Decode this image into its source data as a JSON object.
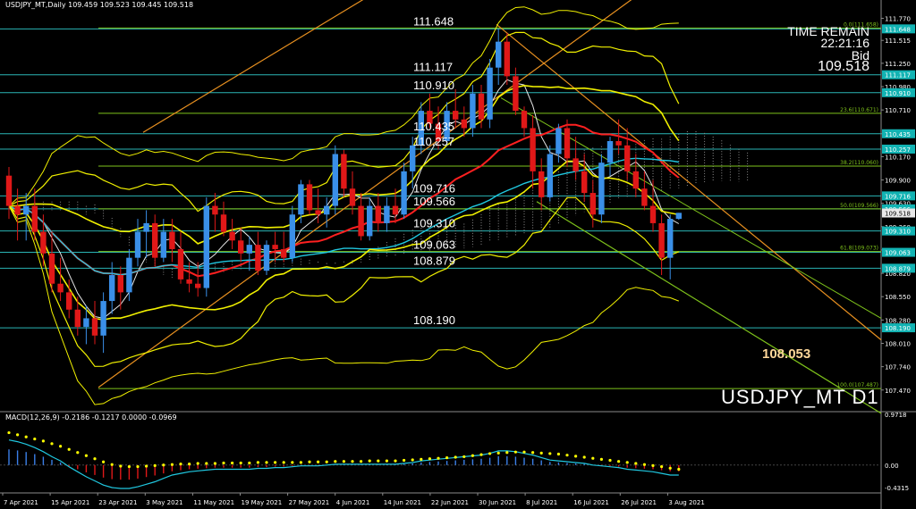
{
  "header_text": "USDJPY_MT,Daily  109.459 109.523 109.445 109.518",
  "symbol_watermark": "USDJPY_MT D1",
  "info_panel": {
    "line1": "TIME REMAIN",
    "line2": "22:21:16",
    "line3": "Bid",
    "line4": "109.518"
  },
  "target_label": "108.053",
  "colors": {
    "background": "#000000",
    "bull": "#3a8fe8",
    "bear": "#e01818",
    "level_line": "#2ab5b5",
    "fib_line": "#7ec21b",
    "channel": "#e89020",
    "bollinger": "#f0f000",
    "ma_red": "#ff2020",
    "ma_white": "#e8e8e8",
    "ma_cyan": "#20c8e0",
    "price_label_bg": "#12b3b3"
  },
  "chart_data": [
    {
      "type": "candlestick",
      "symbol": "USDJPY_MT",
      "timeframe": "Daily",
      "ylim": [
        107.23,
        111.92
      ],
      "y_ticks": [
        "111.770",
        "111.515",
        "111.250",
        "110.980",
        "110.710",
        "110.435",
        "110.170",
        "109.900",
        "109.630",
        "109.360",
        "109.090",
        "108.820",
        "108.550",
        "108.280",
        "108.010",
        "107.740",
        "107.470"
      ],
      "x_tick_labels": [
        "7 Apr 2021",
        "15 Apr 2021",
        "23 Apr 2021",
        "3 May 2021",
        "11 May 2021",
        "19 May 2021",
        "27 May 2021",
        "4 Jun 2021",
        "14 Jun 2021",
        "22 Jun 2021",
        "30 Jun 2021",
        "8 Jul 2021",
        "16 Jul 2021",
        "26 Jul 2021",
        "3 Aug 2021"
      ],
      "candles": [
        [
          109.95,
          110.05,
          109.45,
          109.6
        ],
        [
          109.6,
          109.8,
          109.2,
          109.5
        ],
        [
          109.5,
          109.75,
          109.2,
          109.6
        ],
        [
          109.6,
          109.8,
          109.2,
          109.3
        ],
        [
          109.3,
          109.5,
          108.9,
          109.05
        ],
        [
          109.05,
          109.3,
          108.6,
          108.7
        ],
        [
          108.7,
          109.0,
          108.5,
          108.6
        ],
        [
          108.6,
          108.75,
          108.3,
          108.4
        ],
        [
          108.4,
          108.55,
          108.1,
          108.2
        ],
        [
          108.2,
          108.45,
          108.0,
          108.3
        ],
        [
          108.3,
          108.5,
          108.0,
          108.1
        ],
        [
          108.1,
          108.6,
          107.9,
          108.5
        ],
        [
          108.5,
          108.95,
          108.35,
          108.8
        ],
        [
          108.8,
          108.9,
          108.4,
          108.6
        ],
        [
          108.6,
          109.1,
          108.5,
          109.0
        ],
        [
          109.0,
          109.45,
          108.9,
          109.3
        ],
        [
          109.3,
          109.55,
          109.0,
          109.4
        ],
        [
          109.4,
          109.5,
          108.9,
          109.0
        ],
        [
          109.0,
          109.45,
          108.95,
          109.3
        ],
        [
          109.3,
          109.45,
          108.95,
          109.1
        ],
        [
          109.1,
          109.3,
          108.7,
          108.75
        ],
        [
          108.75,
          108.95,
          108.6,
          108.7
        ],
        [
          108.7,
          108.95,
          108.55,
          108.65
        ],
        [
          108.65,
          109.7,
          108.55,
          109.6
        ],
        [
          109.6,
          109.75,
          109.3,
          109.5
        ],
        [
          109.5,
          109.65,
          109.25,
          109.3
        ],
        [
          109.3,
          109.45,
          109.1,
          109.2
        ],
        [
          109.2,
          109.35,
          108.95,
          109.05
        ],
        [
          109.05,
          109.25,
          108.85,
          109.15
        ],
        [
          109.15,
          109.3,
          108.8,
          108.85
        ],
        [
          108.85,
          109.2,
          108.8,
          109.15
        ],
        [
          109.15,
          109.3,
          108.95,
          109.1
        ],
        [
          109.1,
          109.3,
          108.95,
          109.0
        ],
        [
          109.0,
          109.6,
          108.95,
          109.5
        ],
        [
          109.5,
          109.9,
          109.4,
          109.85
        ],
        [
          109.85,
          109.9,
          109.5,
          109.55
        ],
        [
          109.55,
          109.8,
          109.4,
          109.5
        ],
        [
          109.5,
          109.7,
          109.35,
          109.6
        ],
        [
          109.6,
          110.3,
          109.5,
          110.2
        ],
        [
          110.2,
          110.25,
          109.7,
          109.8
        ],
        [
          109.8,
          110.0,
          109.5,
          109.6
        ],
        [
          109.6,
          109.75,
          109.2,
          109.25
        ],
        [
          109.25,
          109.7,
          109.2,
          109.6
        ],
        [
          109.6,
          109.75,
          109.3,
          109.4
        ],
        [
          109.4,
          109.7,
          109.3,
          109.6
        ],
        [
          109.6,
          109.8,
          109.4,
          109.5
        ],
        [
          109.5,
          110.1,
          109.45,
          110.0
        ],
        [
          110.0,
          110.4,
          109.8,
          110.3
        ],
        [
          110.3,
          110.8,
          110.2,
          110.7
        ],
        [
          110.7,
          110.9,
          110.5,
          110.55
        ],
        [
          110.55,
          110.75,
          110.25,
          110.35
        ],
        [
          110.35,
          110.8,
          110.3,
          110.7
        ],
        [
          110.7,
          110.95,
          110.5,
          110.6
        ],
        [
          110.6,
          110.75,
          110.4,
          110.5
        ],
        [
          110.5,
          111.0,
          110.4,
          110.9
        ],
        [
          110.9,
          111.0,
          110.5,
          110.6
        ],
        [
          110.6,
          111.3,
          110.5,
          111.2
        ],
        [
          111.2,
          111.65,
          111.0,
          111.5
        ],
        [
          111.5,
          111.6,
          111.0,
          111.1
        ],
        [
          111.1,
          111.2,
          110.65,
          110.7
        ],
        [
          110.7,
          110.75,
          110.4,
          110.5
        ],
        [
          110.5,
          110.65,
          109.8,
          110.0
        ],
        [
          110.0,
          110.15,
          109.55,
          109.7
        ],
        [
          109.7,
          110.3,
          109.65,
          110.2
        ],
        [
          110.2,
          110.55,
          110.1,
          110.5
        ],
        [
          110.5,
          110.6,
          110.05,
          110.15
        ],
        [
          110.15,
          110.4,
          109.9,
          110.0
        ],
        [
          110.0,
          110.2,
          109.65,
          109.75
        ],
        [
          109.75,
          109.9,
          109.35,
          109.5
        ],
        [
          109.5,
          110.2,
          109.4,
          110.1
        ],
        [
          110.1,
          110.4,
          109.95,
          110.35
        ],
        [
          110.35,
          110.6,
          110.2,
          110.3
        ],
        [
          110.3,
          110.5,
          109.9,
          110.0
        ],
        [
          110.0,
          110.2,
          109.7,
          109.8
        ],
        [
          109.8,
          110.0,
          109.55,
          109.6
        ],
        [
          109.6,
          109.9,
          109.3,
          109.4
        ],
        [
          109.4,
          109.5,
          108.8,
          109.0
        ],
        [
          109.0,
          109.5,
          108.75,
          109.45
        ],
        [
          109.45,
          109.52,
          109.44,
          109.52
        ]
      ],
      "horizontal_levels": [
        111.648,
        111.117,
        110.91,
        110.435,
        110.257,
        109.716,
        109.566,
        109.31,
        109.063,
        108.879,
        108.19
      ],
      "fibonacci_levels": [
        {
          "label": "0.0(111.658)",
          "price": 111.658
        },
        {
          "label": "23.6(110.671)",
          "price": 110.671
        },
        {
          "label": "38.2(110.060)",
          "price": 110.06
        },
        {
          "label": "50.0(109.566)",
          "price": 109.566
        },
        {
          "label": "61.8(109.073)",
          "price": 109.073
        },
        {
          "label": "100.0(107.487)",
          "price": 107.487
        }
      ],
      "price_axis_labels": [
        {
          "text": "111.648",
          "price": 111.648
        },
        {
          "text": "111.117",
          "price": 111.117
        },
        {
          "text": "110.910",
          "price": 110.91
        },
        {
          "text": "110.435",
          "price": 110.435
        },
        {
          "text": "110.257",
          "price": 110.257
        },
        {
          "text": "109.716",
          "price": 109.716
        },
        {
          "text": "109.566",
          "price": 109.566
        },
        {
          "text": "109.518",
          "price": 109.518
        },
        {
          "text": "109.310",
          "price": 109.31
        },
        {
          "text": "109.063",
          "price": 109.063
        },
        {
          "text": "108.879",
          "price": 108.879
        },
        {
          "text": "108.190",
          "price": 108.19
        }
      ],
      "level_text_labels": [
        "111.648",
        "111.117",
        "110.910",
        "110.435",
        "110.257",
        "109.716",
        "109.566",
        "109.310",
        "109.063",
        "108.879",
        "108.190"
      ]
    },
    {
      "type": "bar",
      "title": "MACD(12,26,9) -0.2186 -0.1217 0.0000 -0.0969",
      "ylim": [
        -0.4315,
        0.9718
      ],
      "y_ticks": [
        "0.9718",
        "0.00",
        "-0.4315"
      ],
      "histogram": [
        0.3,
        0.28,
        0.25,
        0.21,
        0.16,
        0.1,
        0.05,
        -0.02,
        -0.08,
        -0.14,
        -0.19,
        -0.24,
        -0.27,
        -0.28,
        -0.28,
        -0.26,
        -0.23,
        -0.2,
        -0.16,
        -0.12,
        -0.1,
        -0.08,
        -0.07,
        -0.06,
        -0.05,
        -0.05,
        -0.05,
        -0.05,
        -0.05,
        -0.04,
        -0.04,
        -0.03,
        -0.03,
        -0.02,
        -0.01,
        -0.01,
        -0.01,
        0.0,
        0.01,
        0.01,
        0.01,
        0.01,
        0.01,
        0.01,
        0.01,
        0.01,
        0.02,
        0.03,
        0.05,
        0.06,
        0.07,
        0.08,
        0.09,
        0.1,
        0.11,
        0.12,
        0.14,
        0.17,
        0.17,
        0.16,
        0.14,
        0.12,
        0.09,
        0.06,
        0.05,
        0.04,
        0.03,
        0.02,
        0.0,
        -0.01,
        -0.02,
        -0.03,
        -0.05,
        -0.06,
        -0.07,
        -0.08,
        -0.1,
        -0.12,
        -0.12
      ],
      "signal": [
        0.62,
        0.58,
        0.54,
        0.5,
        0.46,
        0.41,
        0.36,
        0.3,
        0.24,
        0.18,
        0.12,
        0.06,
        0.01,
        -0.02,
        -0.03,
        -0.03,
        -0.02,
        -0.01,
        0.0,
        0.01,
        0.02,
        0.02,
        0.03,
        0.03,
        0.03,
        0.04,
        0.04,
        0.04,
        0.04,
        0.05,
        0.05,
        0.05,
        0.05,
        0.05,
        0.05,
        0.06,
        0.06,
        0.06,
        0.07,
        0.07,
        0.07,
        0.07,
        0.08,
        0.08,
        0.08,
        0.08,
        0.09,
        0.1,
        0.11,
        0.12,
        0.13,
        0.14,
        0.15,
        0.16,
        0.18,
        0.2,
        0.22,
        0.23,
        0.24,
        0.25,
        0.25,
        0.24,
        0.23,
        0.22,
        0.21,
        0.19,
        0.17,
        0.15,
        0.13,
        0.11,
        0.09,
        0.07,
        0.05,
        0.03,
        0.01,
        -0.01,
        -0.03,
        -0.06,
        -0.08
      ]
    }
  ]
}
